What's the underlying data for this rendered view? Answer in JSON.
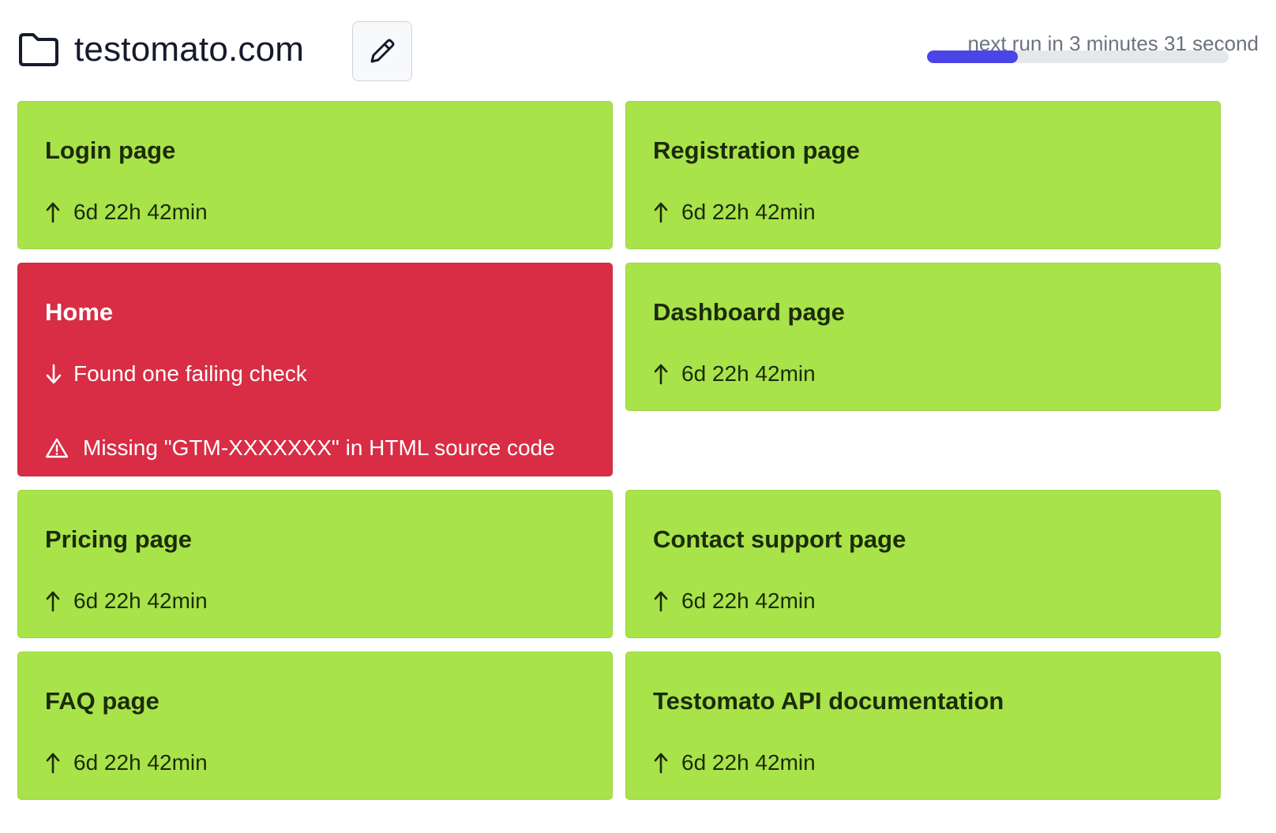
{
  "header": {
    "title": "testomato.com",
    "next_run": "next run in 3 minutes 31 second",
    "progress_fraction": 0.3
  },
  "colors": {
    "ok": "#a8e34a",
    "fail": "#d82d45",
    "progress": "#4b44e6"
  },
  "cards": [
    {
      "title": "Login page",
      "status": "6d 22h 42min",
      "state": "ok",
      "arrow": "arrow-up-icon"
    },
    {
      "title": "Registration page",
      "status": "6d 22h 42min",
      "state": "ok",
      "arrow": "arrow-up-icon"
    },
    {
      "title": "Home",
      "status": "Found one failing check",
      "state": "fail",
      "arrow": "arrow-down-icon",
      "warning": "Missing \"GTM-XXXXXXX\" in HTML source code",
      "warning_icon": "warning-triangle-icon"
    },
    {
      "title": "Dashboard page",
      "status": "6d 22h 42min",
      "state": "ok",
      "arrow": "arrow-up-icon"
    },
    {
      "title": "Pricing page",
      "status": "6d 22h 42min",
      "state": "ok",
      "arrow": "arrow-up-icon"
    },
    {
      "title": "Contact support page",
      "status": "6d 22h 42min",
      "state": "ok",
      "arrow": "arrow-up-icon"
    },
    {
      "title": "FAQ page",
      "status": "6d 22h 42min",
      "state": "ok",
      "arrow": "arrow-up-icon"
    },
    {
      "title": "Testomato API documentation",
      "status": "6d 22h 42min",
      "state": "ok",
      "arrow": "arrow-up-icon"
    }
  ]
}
